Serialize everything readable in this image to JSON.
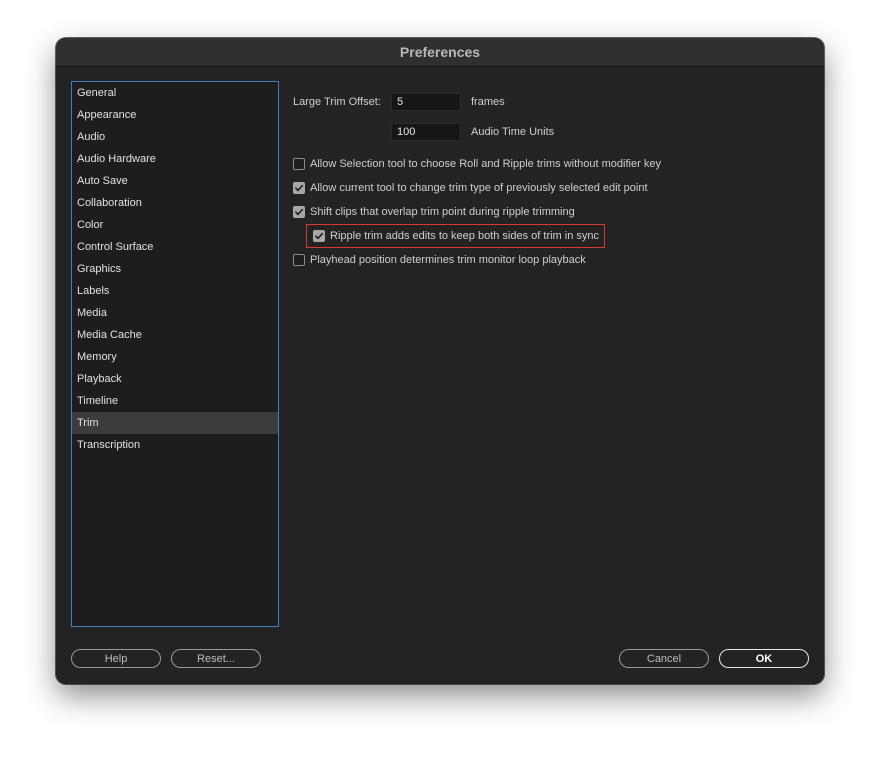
{
  "window": {
    "title": "Preferences"
  },
  "sidebar": {
    "items": [
      {
        "label": "General"
      },
      {
        "label": "Appearance"
      },
      {
        "label": "Audio"
      },
      {
        "label": "Audio Hardware"
      },
      {
        "label": "Auto Save"
      },
      {
        "label": "Collaboration"
      },
      {
        "label": "Color"
      },
      {
        "label": "Control Surface"
      },
      {
        "label": "Graphics"
      },
      {
        "label": "Labels"
      },
      {
        "label": "Media"
      },
      {
        "label": "Media Cache"
      },
      {
        "label": "Memory"
      },
      {
        "label": "Playback"
      },
      {
        "label": "Timeline"
      },
      {
        "label": "Trim",
        "selected": true
      },
      {
        "label": "Transcription"
      }
    ]
  },
  "trim": {
    "large_trim_offset_label": "Large Trim Offset:",
    "frames_value": "5",
    "frames_unit": "frames",
    "audio_value": "100",
    "audio_unit": "Audio Time Units",
    "options": [
      {
        "label": "Allow Selection tool to choose Roll and Ripple trims without modifier key",
        "checked": false
      },
      {
        "label": "Allow current tool to change trim type of previously selected edit point",
        "checked": true
      },
      {
        "label": "Shift clips that overlap trim point during ripple trimming",
        "checked": true
      },
      {
        "label": "Ripple trim adds edits to keep both sides of trim in sync",
        "checked": true,
        "highlighted": true
      },
      {
        "label": "Playhead position determines trim monitor loop playback",
        "checked": false
      }
    ]
  },
  "buttons": {
    "help": "Help",
    "reset": "Reset...",
    "cancel": "Cancel",
    "ok": "OK"
  },
  "colors": {
    "background": "#232323",
    "selection_border": "#3d7ec9",
    "highlight": "#d83a2f"
  }
}
